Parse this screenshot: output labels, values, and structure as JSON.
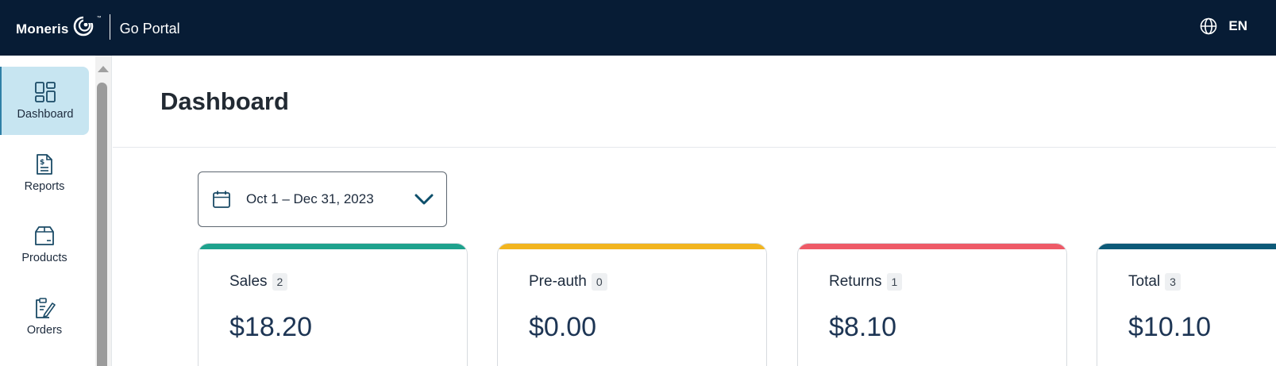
{
  "header": {
    "brand_name": "Moneris",
    "brand_tm": "™",
    "portal_name": "Go Portal",
    "language_code": "EN",
    "background_color": "#071c35"
  },
  "sidebar": {
    "items": [
      {
        "label": "Dashboard",
        "icon": "dashboard-icon",
        "active": true
      },
      {
        "label": "Reports",
        "icon": "report-document-icon",
        "active": false
      },
      {
        "label": "Products",
        "icon": "product-box-icon",
        "active": false
      },
      {
        "label": "Orders",
        "icon": "orders-clipboard-icon",
        "active": false
      }
    ],
    "active_color": "#c7e5f1"
  },
  "page": {
    "title": "Dashboard"
  },
  "date_range": {
    "value": "Oct 1 – Dec 31, 2023"
  },
  "summary_cards": [
    {
      "label": "Sales",
      "count": "2",
      "amount": "$18.20",
      "accent_color": "#1ea28d"
    },
    {
      "label": "Pre-auth",
      "count": "0",
      "amount": "$0.00",
      "accent_color": "#f2b51f"
    },
    {
      "label": "Returns",
      "count": "1",
      "amount": "$8.10",
      "accent_color": "#ee5a67"
    },
    {
      "label": "Total",
      "count": "3",
      "amount": "$10.10",
      "accent_color": "#0d5a78"
    }
  ]
}
